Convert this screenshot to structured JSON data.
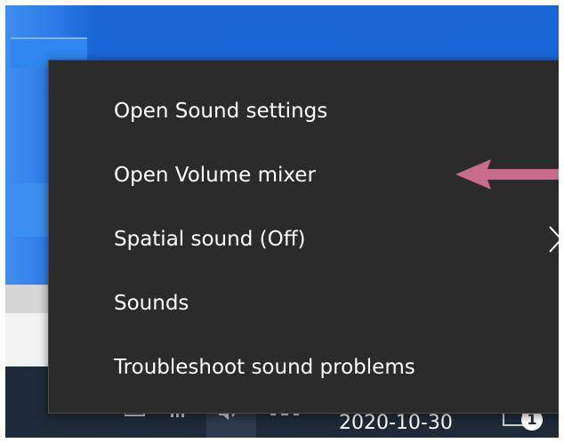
{
  "context_menu": {
    "items": [
      {
        "label": "Open Sound settings",
        "has_submenu": false
      },
      {
        "label": "Open Volume mixer",
        "has_submenu": false,
        "annotated": true
      },
      {
        "label": "Spatial sound (Off)",
        "has_submenu": true
      },
      {
        "label": "Sounds",
        "has_submenu": false
      },
      {
        "label": "Troubleshoot sound problems",
        "has_submenu": false
      }
    ],
    "background": "#2b2b2b",
    "text_color": "#ffffff"
  },
  "annotation": {
    "arrow_color": "#c86b8c",
    "icon": "arrow-left-icon"
  },
  "taskbar": {
    "date": "2020-10-30",
    "notification_count": "1",
    "background": "#1f2a38",
    "icons": [
      "network-icon",
      "volume-icon",
      "notification-icon"
    ]
  },
  "desktop": {
    "wallpaper_color": "#1766d8"
  }
}
